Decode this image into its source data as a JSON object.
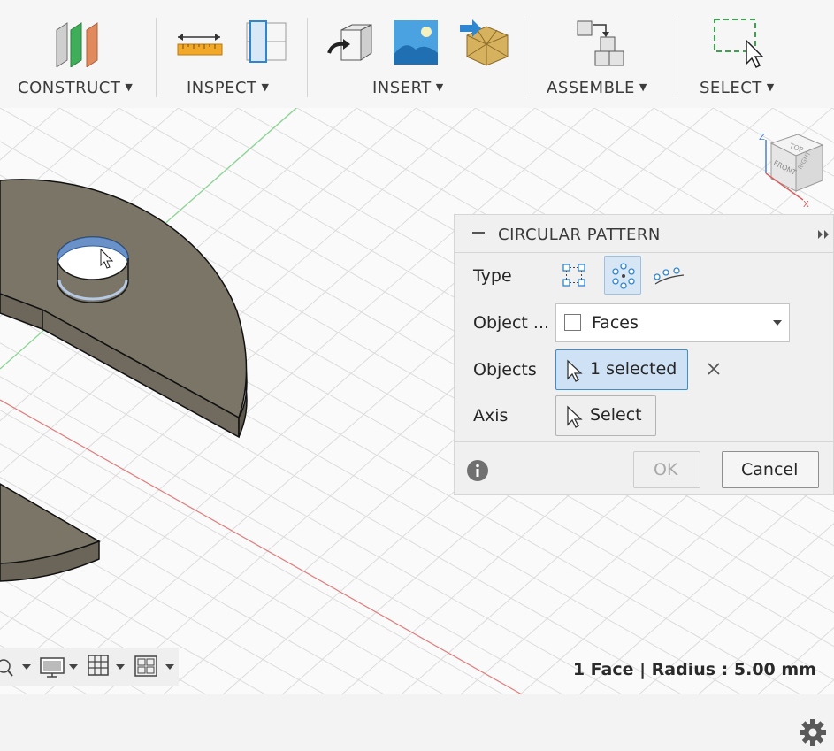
{
  "toolbar": {
    "groups": [
      {
        "label": "CONSTRUCT",
        "icon": "construct-planes-icon"
      },
      {
        "label": "INSPECT",
        "icon": "measure-ruler-icon"
      },
      {
        "label": "INSERT",
        "icon": "insert-image-icon"
      },
      {
        "label": "ASSEMBLE",
        "icon": "assemble-joint-icon"
      },
      {
        "label": "SELECT",
        "icon": "window-select-icon"
      }
    ]
  },
  "dialog": {
    "title": "CIRCULAR PATTERN",
    "rows": {
      "type_label": "Type",
      "object_type_label": "Object ...",
      "object_type_value": "Faces",
      "objects_label": "Objects",
      "objects_value": "1 selected",
      "axis_label": "Axis",
      "axis_value": "Select"
    },
    "type_options": [
      "rectangular-pattern-icon",
      "circular-pattern-icon",
      "pattern-on-path-icon"
    ],
    "selected_type": "circular-pattern-icon",
    "ok_label": "OK",
    "cancel_label": "Cancel"
  },
  "status_text": "1 Face | Radius : 5.00 mm",
  "viewcube": {
    "top": "TOP",
    "front": "FRONT",
    "right": "RIGHT",
    "axis_z": "Z",
    "axis_x": "X"
  },
  "colors": {
    "accent": "#3d8ed0",
    "selection_fill": "#cfe2f5",
    "body": "#7a7566",
    "grid": "#d4d4d4"
  }
}
